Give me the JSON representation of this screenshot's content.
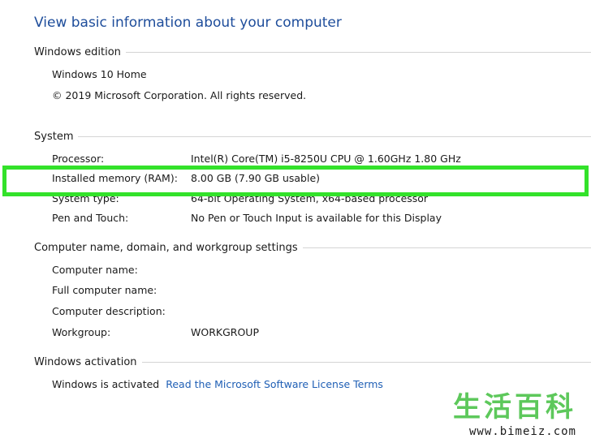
{
  "page_title": "View basic information about your computer",
  "windows_edition": {
    "header": "Windows edition",
    "edition": "Windows 10 Home",
    "copyright": "© 2019 Microsoft Corporation. All rights reserved."
  },
  "system": {
    "header": "System",
    "rows": [
      {
        "label": "Processor:",
        "value": "Intel(R) Core(TM) i5-8250U CPU @ 1.60GHz   1.80 GHz"
      },
      {
        "label": "Installed memory (RAM):",
        "value": "8.00 GB (7.90 GB usable)"
      },
      {
        "label": "System type:",
        "value": "64-bit Operating System, x64-based processor"
      },
      {
        "label": "Pen and Touch:",
        "value": "No Pen or Touch Input is available for this Display"
      }
    ]
  },
  "computer_name": {
    "header": "Computer name, domain, and workgroup settings",
    "rows": [
      {
        "label": "Computer name:",
        "value": ""
      },
      {
        "label": "Full computer name:",
        "value": ""
      },
      {
        "label": "Computer description:",
        "value": ""
      },
      {
        "label": "Workgroup:",
        "value": "WORKGROUP"
      }
    ]
  },
  "activation": {
    "header": "Windows activation",
    "status": "Windows is activated",
    "link": "Read the Microsoft Software License Terms"
  },
  "watermark": {
    "chars": "生活百科",
    "url": "www.bimeiz.com"
  },
  "colors": {
    "title_blue": "#1e4d9b",
    "link_blue": "#1f5fb5",
    "highlight_green": "#33e22a",
    "watermark_green": "#4cc34a"
  }
}
